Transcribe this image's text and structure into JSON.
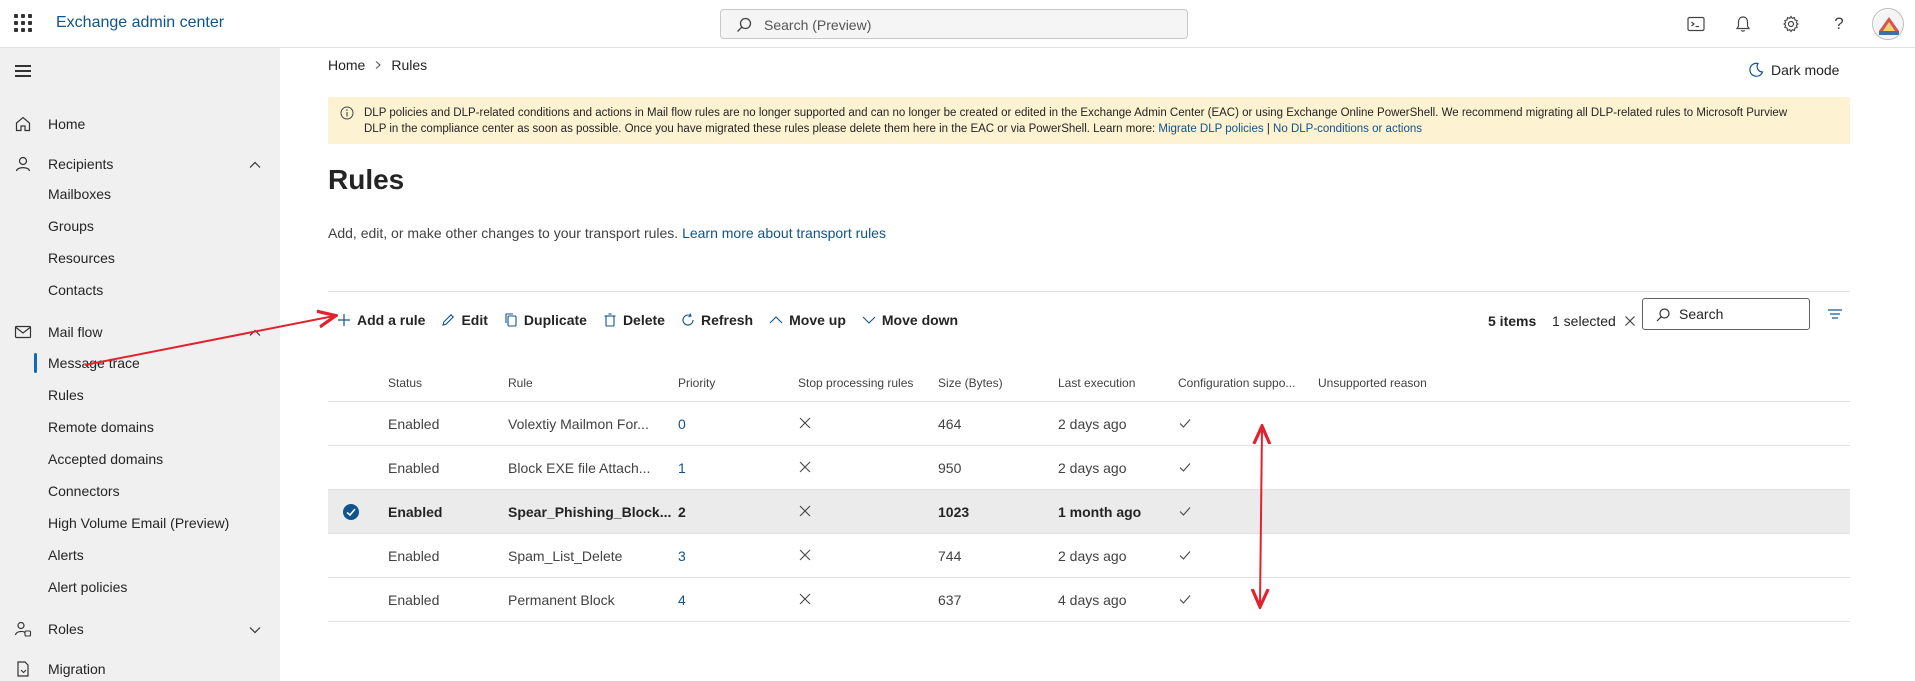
{
  "app": {
    "title": "Exchange admin center"
  },
  "search": {
    "placeholder": "Search (Preview)"
  },
  "topbar_icons": [
    "terminal-icon",
    "bell-icon",
    "gear-icon",
    "help-icon"
  ],
  "sidebar": {
    "items": [
      {
        "label": "Home",
        "icon": "home-icon"
      },
      {
        "label": "Recipients",
        "icon": "person-icon",
        "expanded": true,
        "children": [
          "Mailboxes",
          "Groups",
          "Resources",
          "Contacts"
        ]
      },
      {
        "label": "Mail flow",
        "icon": "mail-icon",
        "expanded": true,
        "children": [
          "Message trace",
          "Rules",
          "Remote domains",
          "Accepted domains",
          "Connectors",
          "High Volume Email (Preview)",
          "Alerts",
          "Alert policies"
        ],
        "selected_child": "Rules"
      },
      {
        "label": "Roles",
        "icon": "roles-icon",
        "expanded": false
      },
      {
        "label": "Migration",
        "icon": "migration-icon"
      }
    ]
  },
  "breadcrumb": {
    "home": "Home",
    "current": "Rules"
  },
  "darkmode": {
    "label": "Dark mode"
  },
  "banner": {
    "text_line1": "DLP policies and DLP-related conditions and actions in Mail flow rules are no longer supported and can no longer be created or edited in the Exchange Admin Center (EAC) or using Exchange Online PowerShell. We recommend migrating all DLP-related rules to Microsoft Purview",
    "text_line2": "DLP in the compliance center as soon as possible. Once you have migrated these rules please delete them here in the EAC or via PowerShell. Learn more:",
    "link1": "Migrate DLP policies",
    "separator": "|",
    "link2": "No DLP-conditions or actions"
  },
  "page": {
    "title": "Rules",
    "description": "Add, edit, or make other changes to your transport rules.",
    "learn_more": "Learn more about transport rules"
  },
  "toolbar": {
    "add": "Add a rule",
    "edit": "Edit",
    "duplicate": "Duplicate",
    "delete": "Delete",
    "refresh": "Refresh",
    "move_up": "Move up",
    "move_down": "Move down",
    "items": "5 items",
    "selected": "1 selected",
    "search_placeholder": "Search"
  },
  "table": {
    "columns": [
      "Status",
      "Rule",
      "Priority",
      "Stop processing rules",
      "Size (Bytes)",
      "Last execution",
      "Configuration suppo...",
      "Unsupported reason"
    ],
    "rows": [
      {
        "status": "Enabled",
        "rule": "Volextiy Mailmon For...",
        "priority": "0",
        "stop": false,
        "size": "464",
        "last": "2 days ago",
        "config": true,
        "selected": false
      },
      {
        "status": "Enabled",
        "rule": "Block EXE file Attach...",
        "priority": "1",
        "stop": false,
        "size": "950",
        "last": "2 days ago",
        "config": true,
        "selected": false
      },
      {
        "status": "Enabled",
        "rule": "Spear_Phishing_Block...",
        "priority": "2",
        "stop": false,
        "size": "1023",
        "last": "1 month ago",
        "config": true,
        "selected": true
      },
      {
        "status": "Enabled",
        "rule": "Spam_List_Delete",
        "priority": "3",
        "stop": false,
        "size": "744",
        "last": "2 days ago",
        "config": true,
        "selected": false
      },
      {
        "status": "Enabled",
        "rule": "Permanent Block",
        "priority": "4",
        "stop": false,
        "size": "637",
        "last": "4 days ago",
        "config": true,
        "selected": false
      }
    ]
  },
  "colors": {
    "accent": "#0f6cbd",
    "banner_bg": "#fdf2d1",
    "annotation": "#e0232e"
  }
}
